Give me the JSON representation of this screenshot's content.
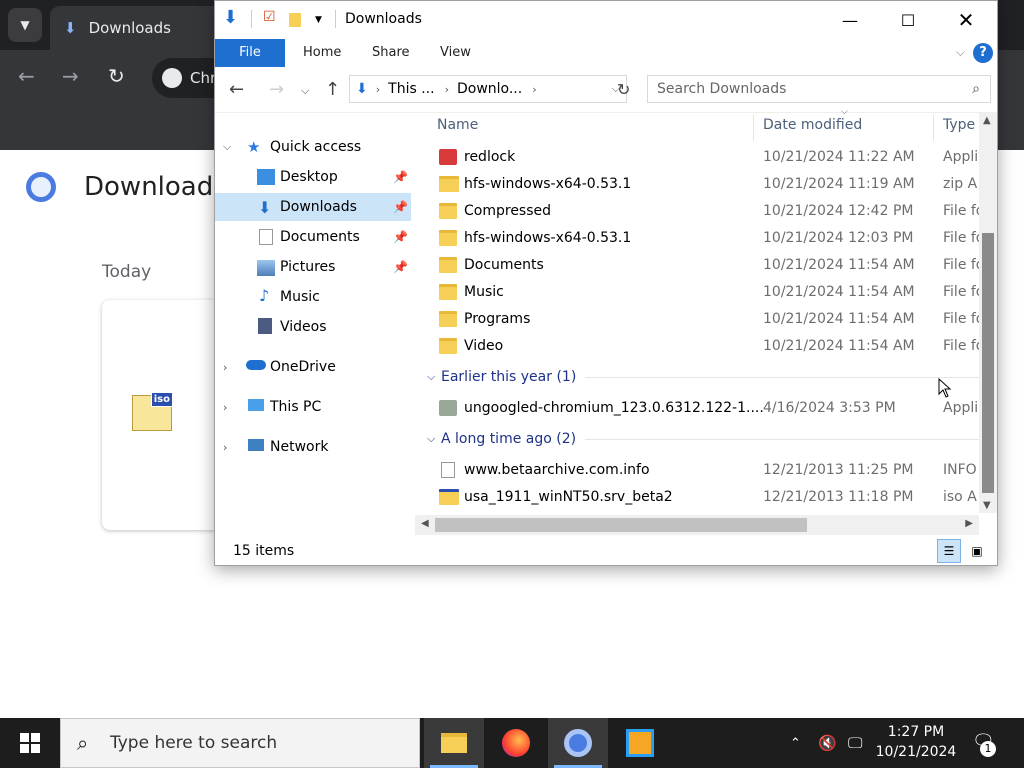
{
  "chrome": {
    "tab_title": "Downloads",
    "omnibox_text": "Chro",
    "page_title": "Download",
    "section_today": "Today"
  },
  "explorer": {
    "title": "Downloads",
    "ribbon_tabs": [
      "File",
      "Home",
      "Share",
      "View"
    ],
    "address": {
      "seg1": "This ...",
      "seg2": "Downlo..."
    },
    "search_placeholder": "Search Downloads",
    "columns": {
      "name": "Name",
      "date": "Date modified",
      "type": "Type"
    },
    "nav": [
      {
        "label": "Quick access"
      },
      {
        "label": "Desktop"
      },
      {
        "label": "Downloads"
      },
      {
        "label": "Documents"
      },
      {
        "label": "Pictures"
      },
      {
        "label": "Music"
      },
      {
        "label": "Videos"
      },
      {
        "label": "OneDrive"
      },
      {
        "label": "This PC"
      },
      {
        "label": "Network"
      }
    ],
    "files_today": [
      {
        "name": "redlock",
        "date": "10/21/2024 11:22 AM",
        "type": "Appli"
      },
      {
        "name": "hfs-windows-x64-0.53.1",
        "date": "10/21/2024 11:19 AM",
        "type": "zip A"
      },
      {
        "name": "Compressed",
        "date": "10/21/2024 12:42 PM",
        "type": "File fo"
      },
      {
        "name": "hfs-windows-x64-0.53.1",
        "date": "10/21/2024 12:03 PM",
        "type": "File fo"
      },
      {
        "name": "Documents",
        "date": "10/21/2024 11:54 AM",
        "type": "File fo"
      },
      {
        "name": "Music",
        "date": "10/21/2024 11:54 AM",
        "type": "File fo"
      },
      {
        "name": "Programs",
        "date": "10/21/2024 11:54 AM",
        "type": "File fo"
      },
      {
        "name": "Video",
        "date": "10/21/2024 11:54 AM",
        "type": "File fo"
      }
    ],
    "group_earlier": "Earlier this year (1)",
    "files_earlier": [
      {
        "name": "ungoogled-chromium_123.0.6312.122-1....",
        "date": "4/16/2024 3:53 PM",
        "type": "Appli"
      }
    ],
    "group_longago": "A long time ago (2)",
    "files_longago": [
      {
        "name": "www.betaarchive.com.info",
        "date": "12/21/2013 11:25 PM",
        "type": "INFO"
      },
      {
        "name": "usa_1911_winNT50.srv_beta2",
        "date": "12/21/2013 11:18 PM",
        "type": "iso A"
      }
    ],
    "status_count": "15 items"
  },
  "taskbar": {
    "search_placeholder": "Type here to search",
    "time": "1:27 PM",
    "date": "10/21/2024",
    "notif_count": "1"
  },
  "colors": {
    "accent": "#1e6fcf",
    "selection": "#cce4f7",
    "folder": "#f5cf56",
    "taskbar": "#1d1d1d"
  }
}
